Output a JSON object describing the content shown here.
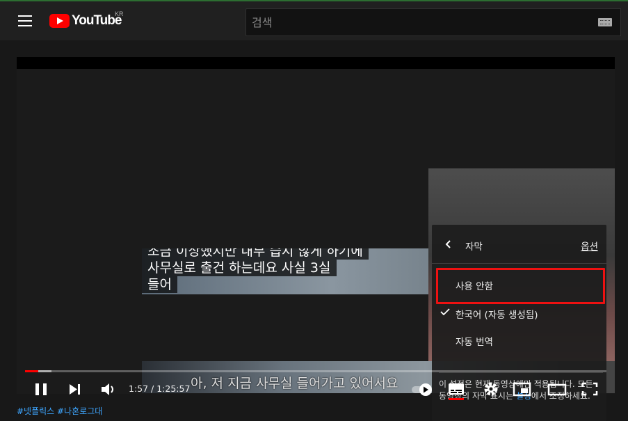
{
  "masthead": {
    "logo_text": "YouTube",
    "country_code": "KR",
    "search_placeholder": "검색"
  },
  "player": {
    "burned_subtitle_lines": [
      "조금 이상했지만 내부 습지 않게 하기에",
      "사무실로 출건 하는데요 사실 3실",
      "들어"
    ],
    "auto_caption": "아, 저 지금 사무실 들어가고 있어서요",
    "time_display": "1:57 / 1:25:57",
    "progress_fraction": 0.023,
    "loaded_fraction": 0.045,
    "colors": {
      "accent": "#ff0000",
      "link": "#3ea6ff",
      "highlight_box": "#e11111"
    }
  },
  "subtitle_menu": {
    "title": "자막",
    "options_label": "옵션",
    "items": [
      {
        "label": "사용 안함",
        "checked": false,
        "highlighted": true
      },
      {
        "label": "한국어 (자동 생성됨)",
        "checked": true,
        "highlighted": false
      },
      {
        "label": "자동 번역",
        "checked": false,
        "highlighted": false
      }
    ],
    "note_before": "이 설정은 현재 동영상에만 적용됩니다. 모든 동영상의 자막 표시는 ",
    "note_link": "설정",
    "note_after": "에서 조정하세요."
  },
  "controls": {
    "icons": [
      "pause-icon",
      "next-icon",
      "volume-icon",
      "autoplay-toggle",
      "subtitles-icon",
      "settings-icon",
      "miniplayer-icon",
      "theater-icon",
      "fullscreen-icon"
    ]
  },
  "description": {
    "hashtags": "#넷플릭스 #나혼로그대"
  }
}
